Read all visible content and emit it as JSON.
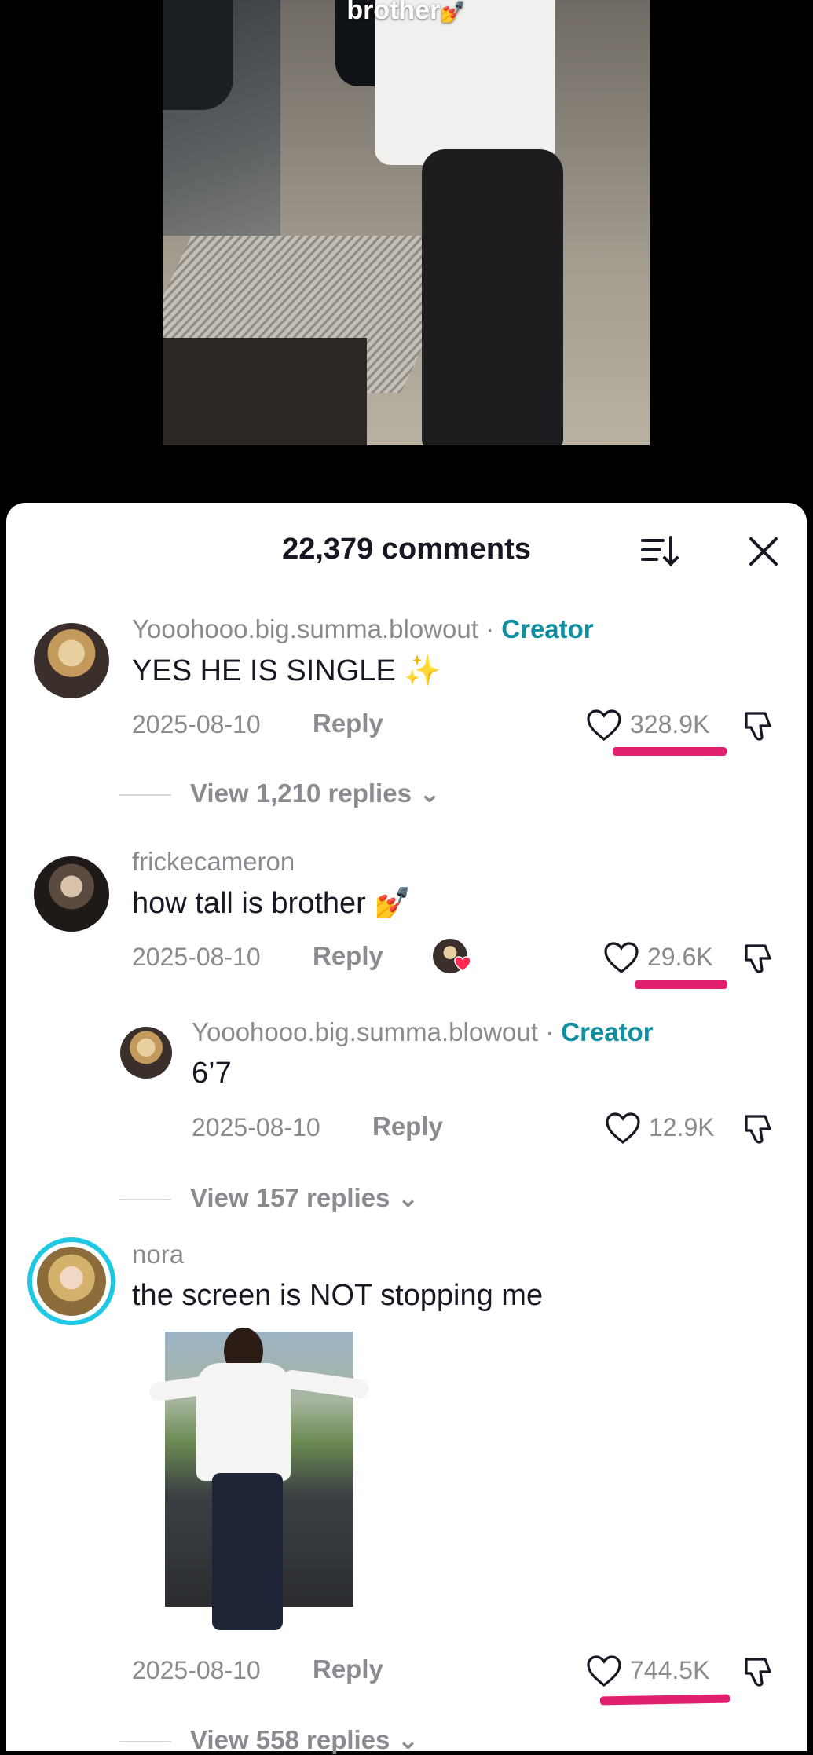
{
  "video": {
    "caption": "brother",
    "caption_emoji": "💅"
  },
  "sheet": {
    "comment_count": "22,379 comments"
  },
  "comments": [
    {
      "username": "Yooohooo.big.summa.blowout",
      "badge": "Creator",
      "text": "YES HE IS SINGLE ✨",
      "date": "2025-08-10",
      "reply_label": "Reply",
      "likes": "328.9K",
      "view_replies": "View 1,210 replies"
    },
    {
      "username": "frickecameron",
      "text": "how tall is brother 💅",
      "date": "2025-08-10",
      "reply_label": "Reply",
      "likes": "29.6K",
      "reply": {
        "username": "Yooohooo.big.summa.blowout",
        "badge": "Creator",
        "text": "6’7",
        "date": "2025-08-10",
        "reply_label": "Reply",
        "likes": "12.9K"
      },
      "view_replies": "View 157 replies"
    },
    {
      "username": "nora",
      "text": "the screen is NOT stopping me",
      "date": "2025-08-10",
      "reply_label": "Reply",
      "likes": "744.5K",
      "view_replies": "View 558 replies"
    }
  ],
  "colors": {
    "accent_underline": "#e0216f",
    "creator_badge": "#0f8f9f",
    "story_ring": "#20c9e3"
  }
}
